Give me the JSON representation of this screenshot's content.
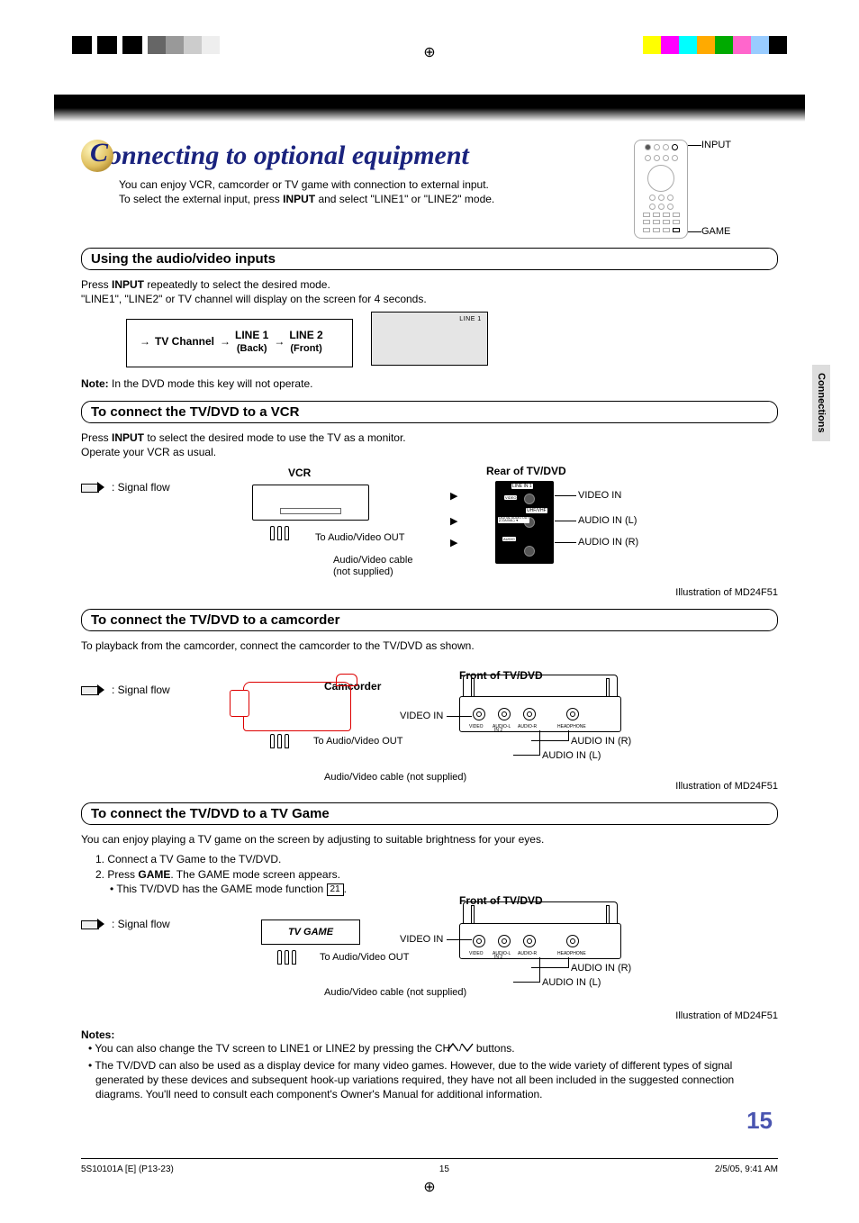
{
  "page_number": "15",
  "title": "onnecting to optional equipment",
  "intro_parts": {
    "a": "You can enjoy VCR, camcorder or TV game with connection to external input. To select the external input, press ",
    "b": "INPUT",
    "c": " and select \"LINE1\" or \"LINE2\" mode."
  },
  "remote": {
    "label_input": "INPUT",
    "label_game": "GAME"
  },
  "side_tab": "Connections",
  "sections": {
    "audio_video_inputs": {
      "heading": "Using the audio/video inputs",
      "line1a": "Press ",
      "line1b": "INPUT",
      "line1c": " repeatedly to select the desired mode.",
      "line2": "\"LINE1\", \"LINE2\" or TV channel will display on the screen for 4 seconds.",
      "cycle": {
        "tv": "TV Channel",
        "l1": "LINE 1",
        "l1sub": "(Back)",
        "l2": "LINE 2",
        "l2sub": "(Front)"
      },
      "screen_text": "LINE 1",
      "note_b": "Note:",
      "note": " In the DVD mode this key will not operate."
    },
    "vcr": {
      "heading": "To connect the TV/DVD to a VCR",
      "line1a": "Press ",
      "line1b": "INPUT",
      "line1c": " to select the desired mode to use the TV as a monitor.",
      "line2": "Operate your VCR as usual.",
      "signal": ": Signal flow",
      "dev": "VCR",
      "to_av": "To Audio/Video OUT",
      "cable1": "Audio/Video cable",
      "cable2": "(not supplied)",
      "rear": "Rear of TV/DVD",
      "video_in": "VIDEO IN",
      "audio_l": "AUDIO IN (L)",
      "audio_r": "AUDIO IN (R)",
      "illus": "Illustration of MD24F51"
    },
    "camcorder": {
      "heading": "To connect the TV/DVD to a camcorder",
      "line1": "To playback from the camcorder, connect the camcorder to the TV/DVD as shown.",
      "signal": ": Signal flow",
      "dev": "Camcorder",
      "to_av": "To Audio/Video OUT",
      "cable": "Audio/Video cable (not supplied)",
      "front": "Front of TV/DVD",
      "video_in": "VIDEO IN",
      "audio_l": "AUDIO IN (L)",
      "audio_r": "AUDIO IN (R)",
      "illus": "Illustration of MD24F51"
    },
    "tvgame": {
      "heading": "To connect the TV/DVD to a TV Game",
      "line1": "You can enjoy playing a TV game on the screen by adjusting to suitable brightness for your eyes.",
      "step1": "1. Connect a TV Game to the TV/DVD.",
      "step2a": "2. Press ",
      "step2b": "GAME",
      "step2c": ". The GAME mode screen appears.",
      "step3a": "• This TV/DVD has the GAME mode function ",
      "step3ref": "21",
      "step3b": ".",
      "signal": ": Signal flow",
      "dev": "TV GAME",
      "to_av": "To Audio/Video OUT",
      "cable": "Audio/Video cable (not supplied)",
      "front": "Front of TV/DVD",
      "video_in": "VIDEO IN",
      "audio_l": "AUDIO IN (L)",
      "audio_r": "AUDIO IN (R)",
      "illus": "Illustration of MD24F51"
    }
  },
  "notes": {
    "heading": "Notes:",
    "n1a": "You can also change the TV screen to LINE1 or LINE2 by pressing the CH ",
    "n1b": " buttons.",
    "n2": "The TV/DVD can also be used as a display device for many video games. However, due to the wide variety of different types of signal generated by these devices and subsequent hook-up variations required, they have not all been included in the suggested connection diagrams. You'll need to consult each component's Owner's Manual for additional information."
  },
  "footer": {
    "left": "5S10101A [E] (P13-23)",
    "center": "15",
    "right": "2/5/05, 9:41 AM"
  }
}
